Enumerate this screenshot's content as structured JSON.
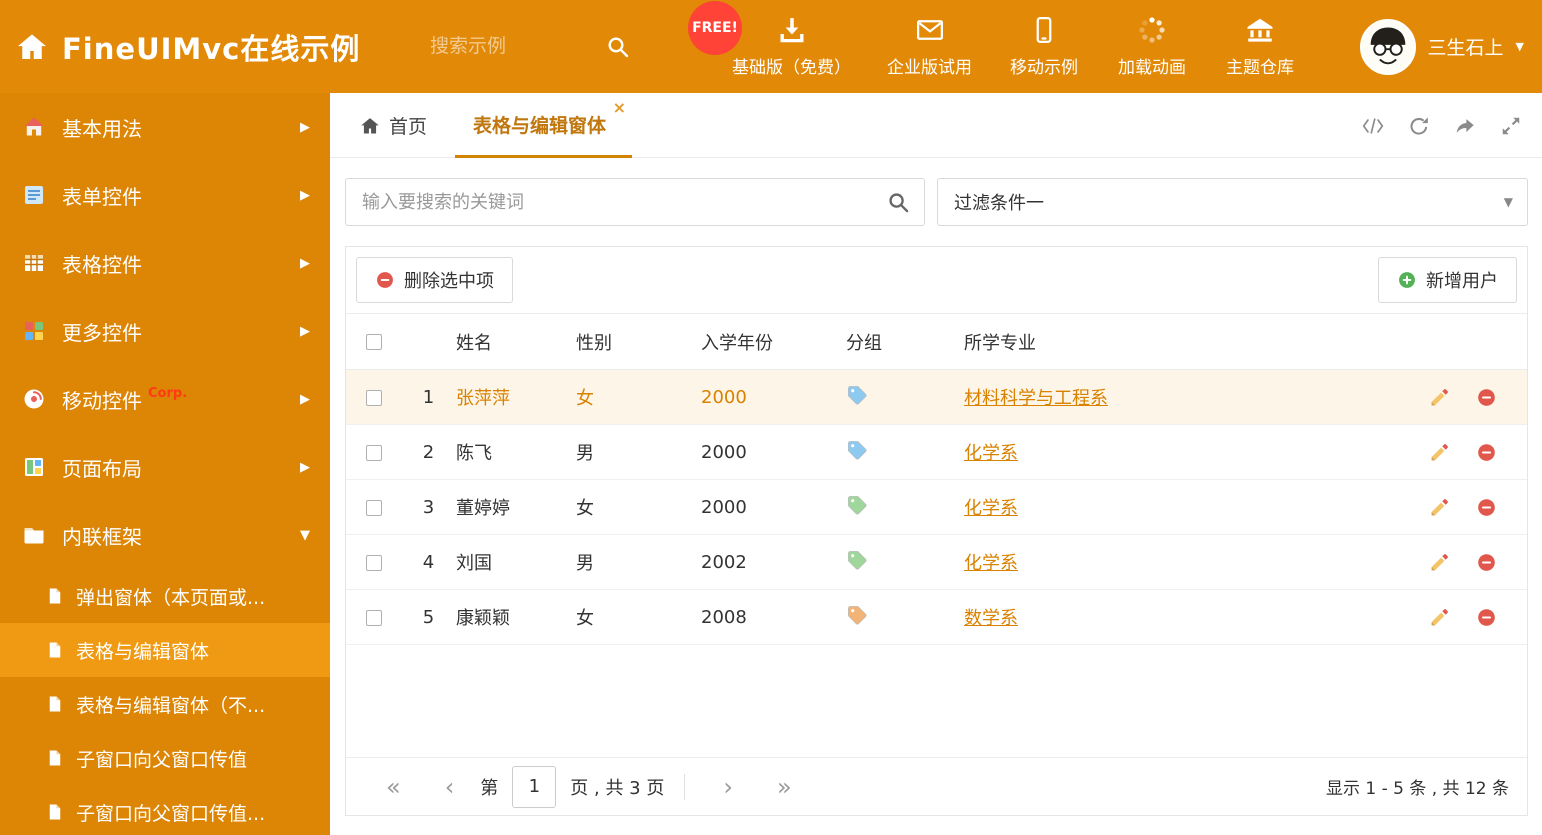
{
  "colors": {
    "header_bg": "#e28908",
    "sidebar_bg": "#dd8504",
    "sidebar_selected_bg": "#ef9a12",
    "accent": "#d98200",
    "tab_active": "#c0770e",
    "row_highlight_bg": "#fdf5e7",
    "red": "#e2574c",
    "green": "#53b156",
    "tag_blue": "#8ec9ef",
    "tag_green": "#9fd69c",
    "tag_orange": "#f2b377"
  },
  "icons": {
    "chevron-down": "▼",
    "chevron-right": "▶",
    "close": "×",
    "first-page": "«",
    "prev-page": "‹",
    "next-page": "›",
    "last-page": "»"
  },
  "header": {
    "title": "FineUIMvc在线示例",
    "search_placeholder": "搜索示例",
    "free_badge": "FREE!",
    "nav": [
      {
        "icon": "download-icon",
        "label": "基础版（免费）"
      },
      {
        "icon": "envelope-icon",
        "label": "企业版试用"
      },
      {
        "icon": "mobile-icon",
        "label": "移动示例"
      },
      {
        "icon": "spinner-icon",
        "label": "加载动画"
      },
      {
        "icon": "bank-icon",
        "label": "主题仓库"
      }
    ],
    "username": "三生石上"
  },
  "sidebar": {
    "items": [
      {
        "icon": "basic-icon",
        "label": "基本用法"
      },
      {
        "icon": "form-icon",
        "label": "表单控件"
      },
      {
        "icon": "table-icon",
        "label": "表格控件"
      },
      {
        "icon": "widgets-icon",
        "label": "更多控件"
      },
      {
        "icon": "mobile-controls-icon",
        "label": "移动控件",
        "badge": "Corp."
      },
      {
        "icon": "layout-icon",
        "label": "页面布局"
      },
      {
        "icon": "frame-icon",
        "label": "内联框架",
        "expanded": true
      }
    ],
    "subitems": [
      {
        "label": "弹出窗体（本页面或..."
      },
      {
        "label": "表格与编辑窗体",
        "selected": true
      },
      {
        "label": "表格与编辑窗体（不..."
      },
      {
        "label": "子窗口向父窗口传值"
      },
      {
        "label": "子窗口向父窗口传值..."
      }
    ]
  },
  "tabs": [
    {
      "label": "首页"
    },
    {
      "label": "表格与编辑窗体",
      "active": true
    }
  ],
  "filter": {
    "search_placeholder": "输入要搜索的关键词",
    "dropdown_value": "过滤条件一"
  },
  "toolbar": {
    "delete_label": "删除选中项",
    "add_label": "新增用户"
  },
  "table": {
    "headers": [
      "姓名",
      "性别",
      "入学年份",
      "分组",
      "所学专业"
    ],
    "rows": [
      {
        "num": "1",
        "name": "张萍萍",
        "gender": "女",
        "year": "2000",
        "tag_color": "blue",
        "major": "材料科学与工程系",
        "highlighted": true
      },
      {
        "num": "2",
        "name": "陈飞",
        "gender": "男",
        "year": "2000",
        "tag_color": "blue",
        "major": "化学系"
      },
      {
        "num": "3",
        "name": "董婷婷",
        "gender": "女",
        "year": "2000",
        "tag_color": "green",
        "major": "化学系"
      },
      {
        "num": "4",
        "name": "刘国",
        "gender": "男",
        "year": "2002",
        "tag_color": "green",
        "major": "化学系"
      },
      {
        "num": "5",
        "name": "康颖颖",
        "gender": "女",
        "year": "2008",
        "tag_color": "orange",
        "major": "数学系"
      }
    ]
  },
  "pagination": {
    "prefix": "第",
    "current_page": "1",
    "suffix": "页 , 共 3 页",
    "summary": "显示 1 - 5 条 , 共 12 条"
  }
}
